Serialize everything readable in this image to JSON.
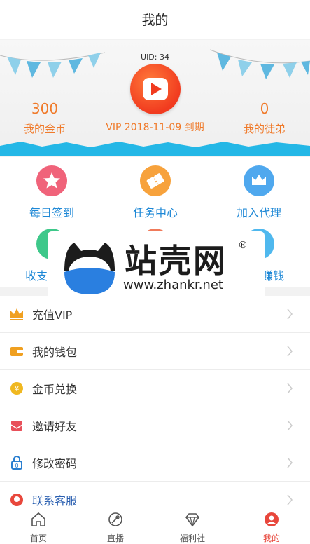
{
  "header": {
    "title": "我的"
  },
  "profile": {
    "uid": "UID: 34",
    "coins_value": "300",
    "coins_label": "我的金币",
    "vip_text": "VIP 2018-11-09 到期",
    "disciples_value": "0",
    "disciples_label": "我的徒弟"
  },
  "grid": {
    "items": [
      {
        "label": "每日签到",
        "icon": "star-icon",
        "color": "#f0637a"
      },
      {
        "label": "任务中心",
        "icon": "ticket-icon",
        "color": "#f7a23c"
      },
      {
        "label": "加入代理",
        "icon": "crown-icon",
        "color": "#4fa8ee"
      },
      {
        "label": "收支",
        "icon": "wallet-icon",
        "color": "#3ec88a"
      },
      {
        "label": "",
        "icon": "gift-icon",
        "color": "#f07a5a"
      },
      {
        "label": "赚钱",
        "icon": "coin-icon",
        "color": "#4fb8ee"
      }
    ]
  },
  "watermark": {
    "brand": "站壳网",
    "url": "www.zhankr.net",
    "reg": "®"
  },
  "menu": {
    "items": [
      {
        "label": "充值VIP",
        "icon": "crown-icon",
        "color": "#f0a020"
      },
      {
        "label": "我的钱包",
        "icon": "wallet-icon",
        "color": "#f0a020"
      },
      {
        "label": "金币兑换",
        "icon": "coin-icon",
        "color": "#f0b820"
      },
      {
        "label": "邀请好友",
        "icon": "invite-icon",
        "color": "#e8505a"
      },
      {
        "label": "修改密码",
        "icon": "lock-icon",
        "color": "#2a7fd0"
      },
      {
        "label": "联系客服",
        "icon": "service-icon",
        "color": "#e8473c"
      }
    ]
  },
  "tabbar": {
    "tabs": [
      {
        "label": "首页",
        "icon": "home-icon"
      },
      {
        "label": "直播",
        "icon": "live-icon"
      },
      {
        "label": "福利社",
        "icon": "diamond-icon"
      },
      {
        "label": "我的",
        "icon": "user-icon"
      }
    ],
    "active_color": "#e8473c"
  }
}
